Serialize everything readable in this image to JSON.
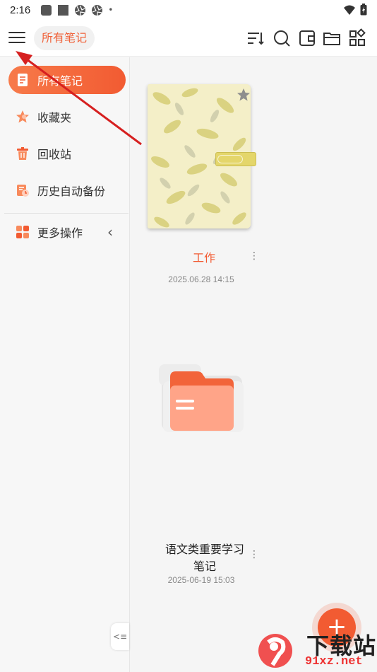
{
  "status_bar": {
    "time": "2:16",
    "dot": "•"
  },
  "app_bar": {
    "title": "所有笔记"
  },
  "sidebar": {
    "items": [
      {
        "label": "所有笔记",
        "icon": "notes-icon",
        "active": true
      },
      {
        "label": "收藏夹",
        "icon": "star-icon",
        "active": false
      },
      {
        "label": "回收站",
        "icon": "trash-icon",
        "active": false
      },
      {
        "label": "历史自动备份",
        "icon": "backup-icon",
        "active": false
      }
    ],
    "more": {
      "label": "更多操作",
      "chevron": "‹"
    },
    "collapse_glyph": "<≡"
  },
  "notes": [
    {
      "title": "工作",
      "date": "2025.06.28 14:15",
      "type": "notebook",
      "starred": true
    },
    {
      "title_line1": "语文类重要学习",
      "title_line2": "笔记",
      "date": "2025-06-19 15:03",
      "type": "folder"
    }
  ],
  "fab": {
    "label": "+"
  },
  "watermark": {
    "brand": "下载站",
    "url": "91xz.net"
  },
  "colors": {
    "accent": "#f25b32",
    "accent_light": "#f77a4a",
    "folder_light": "#ffa488"
  }
}
